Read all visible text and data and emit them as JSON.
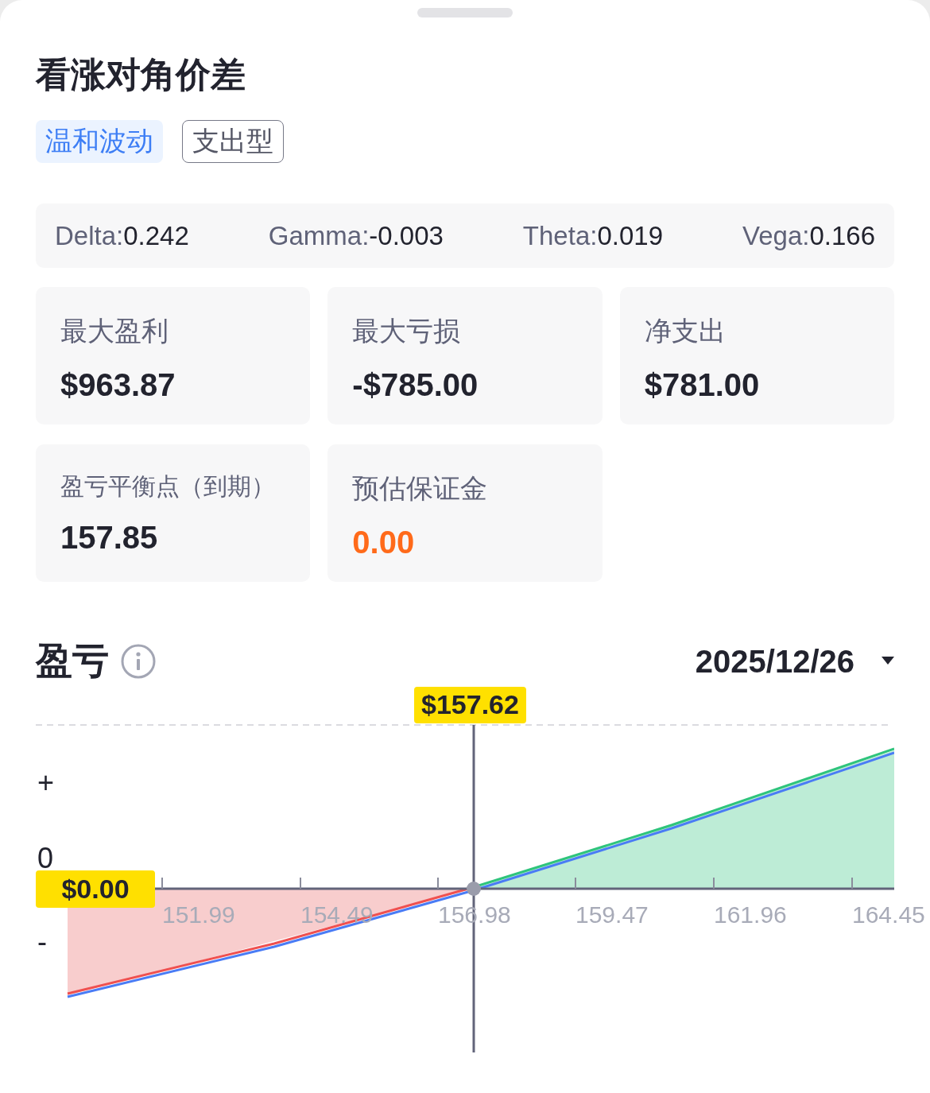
{
  "title": "看涨对角价差",
  "tags": [
    {
      "label": "温和波动",
      "kind": "filled"
    },
    {
      "label": "支出型",
      "kind": "outline"
    }
  ],
  "greeks": [
    {
      "label": "Delta:",
      "value": "0.242"
    },
    {
      "label": "Gamma:",
      "value": "-0.003"
    },
    {
      "label": "Theta:",
      "value": "0.019"
    },
    {
      "label": "Vega:",
      "value": "0.166"
    }
  ],
  "metrics": [
    {
      "label": "最大盈利",
      "value": "$963.87",
      "kind": "normal"
    },
    {
      "label": "最大亏损",
      "value": "-$785.00",
      "kind": "normal"
    },
    {
      "label": "净支出",
      "value": "$781.00",
      "kind": "normal"
    },
    {
      "label": "盈亏平衡点（到期）",
      "value": "157.85",
      "kind": "normal"
    },
    {
      "label": "预估保证金",
      "value": "0.00",
      "kind": "highlight"
    }
  ],
  "pnl": {
    "title": "盈亏",
    "date": "2025/12/26",
    "price_badge": "$157.62",
    "zero_badge": "$0.00",
    "y_labels": [
      "+",
      "0",
      "-"
    ],
    "x_labels": [
      "151.99",
      "154.49",
      "156.98",
      "159.47",
      "161.96",
      "164.45"
    ]
  }
}
